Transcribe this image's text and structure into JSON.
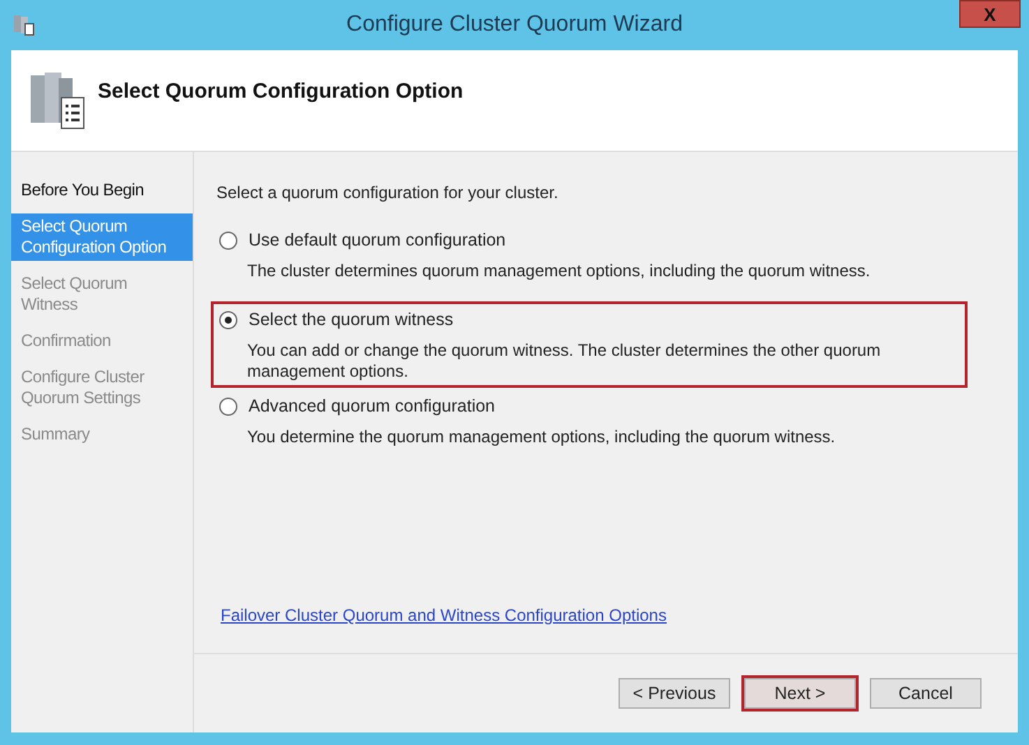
{
  "window": {
    "title": "Configure Cluster Quorum Wizard",
    "close": "X"
  },
  "header": {
    "title": "Select Quorum Configuration Option"
  },
  "steps": [
    {
      "label": "Before You Begin",
      "selected": false,
      "disabled": false
    },
    {
      "label": "Select Quorum Configuration Option",
      "selected": true,
      "disabled": false
    },
    {
      "label": "Select Quorum Witness",
      "selected": false,
      "disabled": true
    },
    {
      "label": "Confirmation",
      "selected": false,
      "disabled": true
    },
    {
      "label": "Configure Cluster Quorum Settings",
      "selected": false,
      "disabled": true
    },
    {
      "label": "Summary",
      "selected": false,
      "disabled": true
    }
  ],
  "prompt": "Select a quorum configuration for your cluster.",
  "options": [
    {
      "label": "Use default quorum configuration",
      "description": "The cluster determines quorum management options, including the quorum witness.",
      "selected": false
    },
    {
      "label": "Select the quorum witness",
      "description": "You can add or change the quorum witness. The cluster determines the other quorum management options.",
      "selected": true,
      "highlighted": true
    },
    {
      "label": "Advanced quorum configuration",
      "description": "You determine the quorum management options, including the quorum witness.",
      "selected": false
    }
  ],
  "link": "Failover Cluster Quorum and Witness Configuration Options",
  "buttons": [
    {
      "label": "< Previous"
    },
    {
      "label": "Next >",
      "highlighted": true
    },
    {
      "label": "Cancel"
    }
  ]
}
